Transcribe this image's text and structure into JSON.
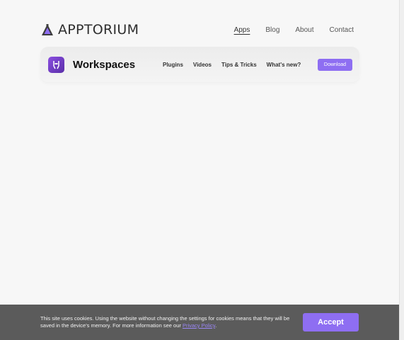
{
  "brand": {
    "logo_text": "APPTORIUM",
    "logo_icon": "flask-triangle-icon"
  },
  "top_nav": {
    "items": [
      {
        "label": "Apps",
        "active": true
      },
      {
        "label": "Blog",
        "active": false
      },
      {
        "label": "About",
        "active": false
      },
      {
        "label": "Contact",
        "active": false
      }
    ]
  },
  "product": {
    "name": "Workspaces",
    "icon": "workspaces-app-icon",
    "nav": [
      {
        "label": "Plugins"
      },
      {
        "label": "Videos"
      },
      {
        "label": "Tips & Tricks"
      },
      {
        "label": "What's new?"
      }
    ],
    "download_label": "Download"
  },
  "cookie": {
    "text": "This site uses cookies. Using the website without changing the settings for cookies means that they will be saved in the device's memory. For more information see our ",
    "link_text": "Privacy Policy",
    "suffix": ".",
    "accept_label": "Accept"
  },
  "colors": {
    "accent": "#8e6ef2",
    "banner_bg": "#5b5b5b",
    "page_bg": "#f7f7f7"
  }
}
